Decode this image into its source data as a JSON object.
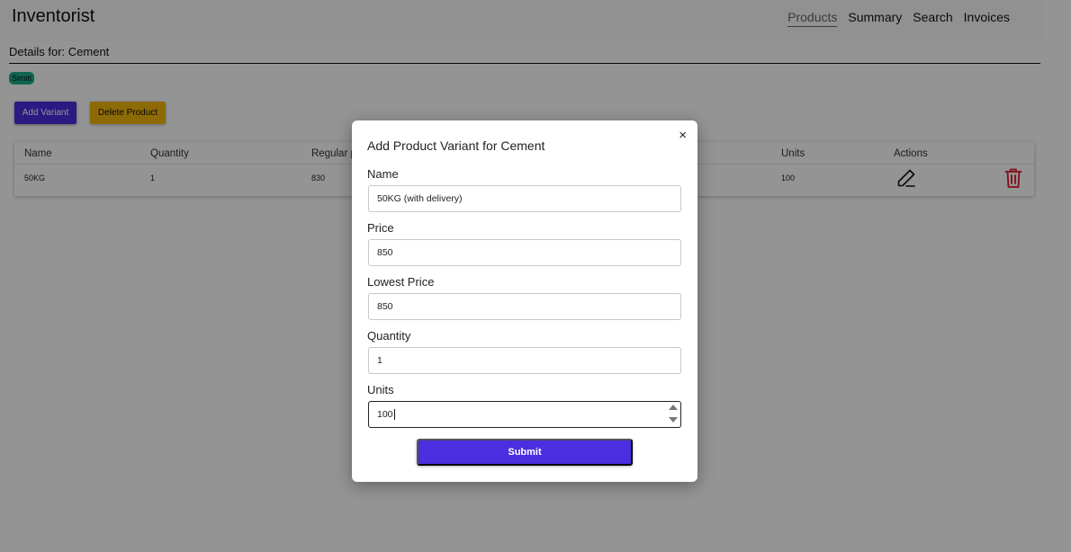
{
  "app": {
    "brand": "Inventorist",
    "nav": [
      "Products",
      "Summary",
      "Search",
      "Invoices"
    ],
    "active_nav": "Products"
  },
  "details": {
    "label": "Details for:",
    "product_name": "Cement",
    "tag": "Simiti"
  },
  "actions": {
    "add_variant": "Add Variant",
    "delete_product": "Delete Product"
  },
  "table": {
    "headers": [
      "Name",
      "Quantity",
      "Regular p",
      "Units",
      "Actions"
    ],
    "rows": [
      {
        "name": "50KG",
        "quantity": "1",
        "regular_price": "830",
        "units": "100"
      }
    ]
  },
  "modal": {
    "title": "Add Product Variant for Cement",
    "close": "×",
    "fields": [
      {
        "label": "Name",
        "value": "50KG (with delivery)"
      },
      {
        "label": "Price",
        "value": "850"
      },
      {
        "label": "Lowest Price",
        "value": "850"
      },
      {
        "label": "Quantity",
        "value": "1"
      },
      {
        "label": "Units",
        "value": "100"
      }
    ],
    "submit": "Submit"
  },
  "colors": {
    "primary": "#4a2ee0",
    "warning": "#f1b70b",
    "tag": "#19b08a",
    "danger": "#e0182a"
  }
}
